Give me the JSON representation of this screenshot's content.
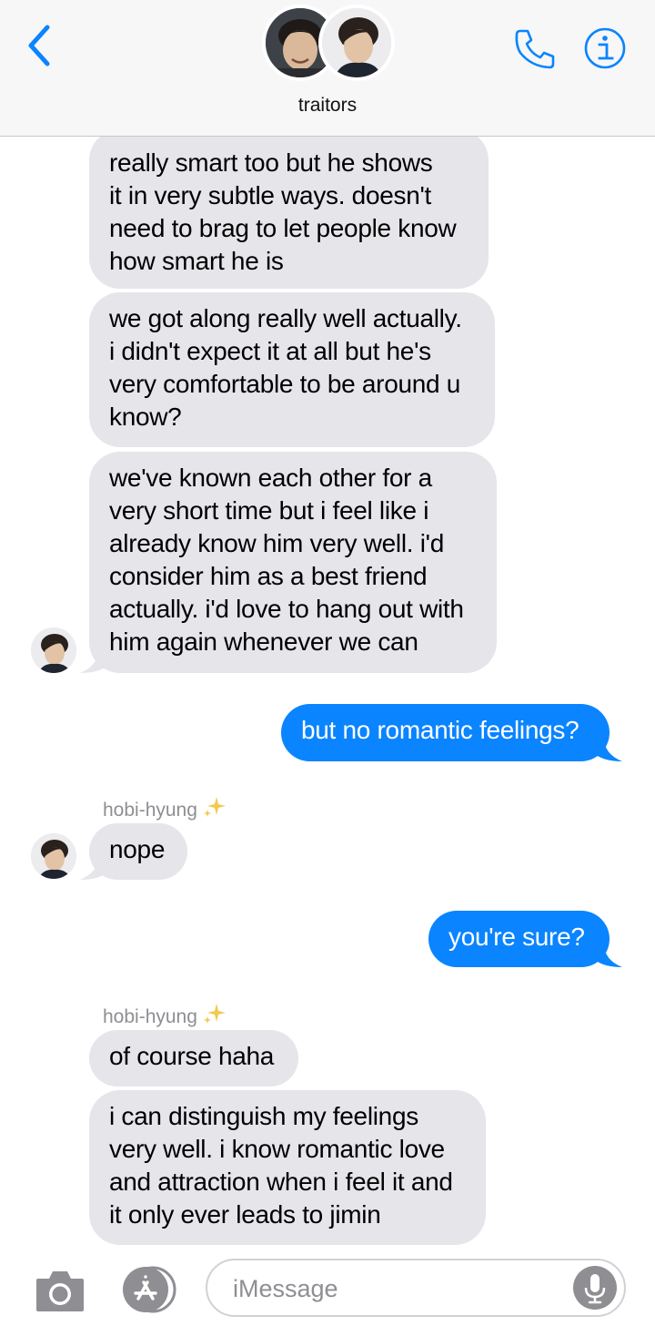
{
  "header": {
    "title": "traitors",
    "back_icon": "chevron-left-icon",
    "call_icon": "phone-icon",
    "info_icon": "info-icon",
    "accent_color": "#0a84ff"
  },
  "messages": [
    {
      "id": "m1",
      "direction": "incoming",
      "text": "really smart too but he shows\nit in very subtle ways. doesn't\nneed to brag to let people know\nhow smart he is"
    },
    {
      "id": "m2",
      "direction": "incoming",
      "text": "we got along really well actually.\ni didn't expect it at all but he's\nvery comfortable to be around u\nknow?"
    },
    {
      "id": "m3",
      "direction": "incoming",
      "text": "we've known each other for a\nvery short time but i feel like i\nalready know him very well. i'd\nconsider him as a best friend\nactually. i'd love to hang out with\nhim again whenever we can"
    },
    {
      "id": "m4",
      "direction": "outgoing",
      "text": "but no romantic feelings?"
    },
    {
      "id": "m5",
      "direction": "incoming",
      "sender": "hobi-hyung",
      "text": "nope"
    },
    {
      "id": "m6",
      "direction": "outgoing",
      "text": "you're sure?"
    },
    {
      "id": "m7",
      "direction": "incoming",
      "sender": "hobi-hyung",
      "text": "of course haha"
    },
    {
      "id": "m8",
      "direction": "incoming",
      "text": "i can distinguish my feelings\nvery well. i know romantic love\nand attraction when i feel it and\nit only ever leads to jimin"
    }
  ],
  "colors": {
    "incoming_bubble": "#e5e5ea",
    "outgoing_bubble": "#0a84ff"
  },
  "input": {
    "placeholder": "iMessage",
    "value": "",
    "camera_icon": "camera-icon",
    "apps_icon": "app-store-icon",
    "mic_icon": "microphone-icon"
  }
}
